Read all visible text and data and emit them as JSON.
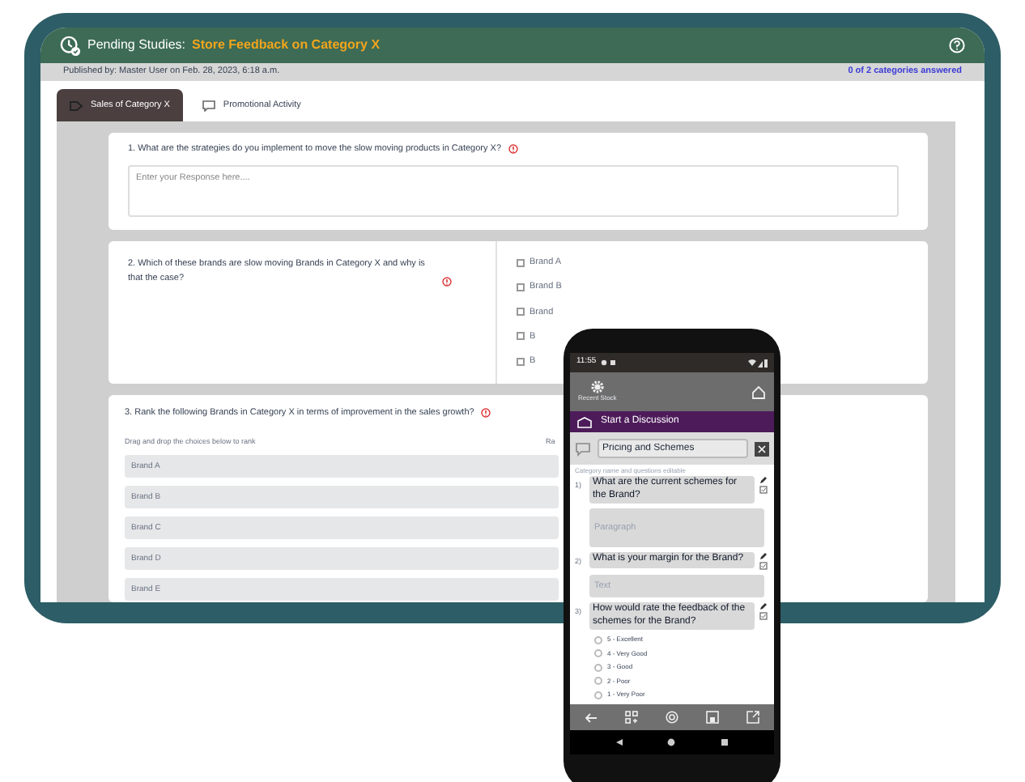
{
  "tablet": {
    "header": {
      "label": "Pending Studies:",
      "study_title": "Store Feedback on Category X"
    },
    "published": "Published by: Master User on Feb. 28, 2023, 6:18 a.m.",
    "progress_link": "0 of 2 categories answered",
    "tabs": [
      {
        "label": "Sales of Category X",
        "selected": true
      },
      {
        "label": "Promotional Activity",
        "selected": false
      }
    ],
    "questions": [
      {
        "kind": "text",
        "prompt": "1. What are the strategies do you implement to move the slow moving products in Category X?",
        "placeholder": "Enter your Response here...."
      },
      {
        "kind": "checkbox",
        "prompt": "2. Which of these brands are slow moving Brands in Category X and why is that the case?",
        "options": [
          {
            "label": "Brand A",
            "checked": false
          },
          {
            "label": "Brand B",
            "checked": false
          },
          {
            "label": "Brand",
            "checked": false
          },
          {
            "label": "B",
            "checked": false
          },
          {
            "label": "B",
            "checked": false
          }
        ]
      },
      {
        "kind": "rank",
        "prompt": "3. Rank the following Brands in Category X in terms of improvement in the sales growth?",
        "column_1": "Drag and drop the choices below to rank",
        "column_2": "Ra",
        "items": [
          "Brand A",
          "Brand B",
          "Brand C",
          "Brand D",
          "Brand E"
        ]
      }
    ]
  },
  "phone": {
    "status_time": "11:55",
    "app_title": "Recent Stock",
    "discussion_button": "Start a Discussion",
    "category_field": {
      "value": "Pricing and Schemes"
    },
    "caption": "Category name and questions editable",
    "questions": [
      {
        "number": "1)",
        "text": "What are the current schemes for the Brand?",
        "kind": "paragraph",
        "answer_placeholder": "Paragraph"
      },
      {
        "number": "2)",
        "text": "What is your margin for the Brand?",
        "kind": "short",
        "answer_placeholder": "Text"
      },
      {
        "number": "3)",
        "text": "How would rate the feedback of the schemes for the Brand?",
        "kind": "rating",
        "options": [
          {
            "label": "5 - Excellent",
            "selected": false
          },
          {
            "label": "4 - Very Good",
            "selected": false
          },
          {
            "label": "3 - Good",
            "selected": false
          },
          {
            "label": "2 - Poor",
            "selected": false
          },
          {
            "label": "1 - Very Poor",
            "selected": false
          }
        ]
      }
    ]
  }
}
